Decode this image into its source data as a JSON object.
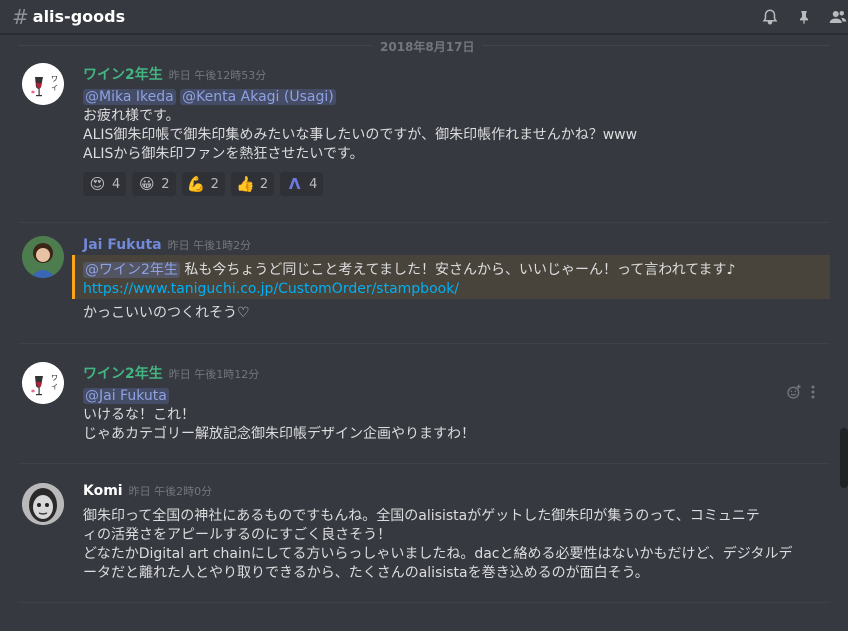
{
  "header": {
    "hash": "#",
    "channel": "alis-goods",
    "icons": [
      "bell-icon",
      "pin-icon",
      "members-icon"
    ]
  },
  "date_divider": "2018年8月17日",
  "messages": [
    {
      "author": "ワイン2年生",
      "author_color": "#43b581",
      "timestamp": "昨日 午後12時53分",
      "mentions": [
        "@Mika Ikeda",
        "@Kenta Akagi (Usagi)"
      ],
      "lines": [
        "お疲れ様です。",
        "ALIS御朱印帳で御朱印集めみたいな事したいのですが、御朱印帳作れませんかね？www",
        "ALISから御朱印ファンを熱狂させたいです。"
      ],
      "reactions": [
        {
          "emoji": "😍",
          "count": "4"
        },
        {
          "emoji": "😀",
          "count": "2"
        },
        {
          "emoji": "💪",
          "count": "2"
        },
        {
          "emoji": "👍",
          "count": "2"
        },
        {
          "emoji": "Λ",
          "count": "4"
        }
      ]
    },
    {
      "author": "Jai Fukuta",
      "author_color": "#7289da",
      "timestamp": "昨日 午後1時2分",
      "mention": "@ワイン2年生",
      "highlight_text": " 私も今ちょうど同じこと考えてました！安さんから、いいじゃーん！って言われてます♪",
      "link": "https://www.taniguchi.co.jp/CustomOrder/stampbook/",
      "line": "かっこいいのつくれそう♡"
    },
    {
      "author": "ワイン2年生",
      "author_color": "#43b581",
      "timestamp": "昨日 午後1時12分",
      "mention": "@Jai Fukuta",
      "lines": [
        "いけるな！これ！",
        "じゃあカテゴリー解放記念御朱印帳デザイン企画やりますわ！"
      ]
    },
    {
      "author": "Komi",
      "author_color": "#ffffff",
      "timestamp": "昨日 午後2時0分",
      "lines": [
        "御朱印って全国の神社にあるものですもんね。全国のalisistaがゲットした御朱印が集うのって、コミュニテ",
        "ィの活発さをアピールするのにすごく良さそう！",
        "どなたかDigital art chainにしてる方いらっしゃいましたね。dacと絡める必要性はないかもだけど、デジタルデ",
        "ータだと離れた人とやり取りできるから、たくさんのalisistaを巻き込めるのが面白そう。"
      ]
    }
  ]
}
